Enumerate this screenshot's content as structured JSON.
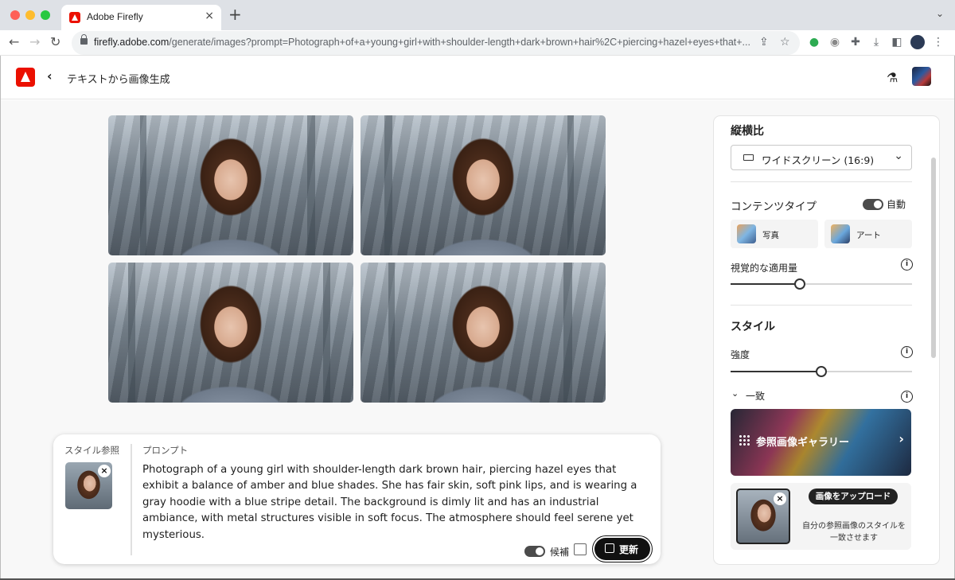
{
  "browser": {
    "tab_title": "Adobe Firefly",
    "new_tab": "+",
    "url_host": "firefly.adobe.com",
    "url_path": "/generate/images?prompt=Photograph+of+a+young+girl+with+shoulder-length+dark+brown+hair%2C+piercing+hazel+eyes+that+..."
  },
  "header": {
    "title": "テキストから画像生成"
  },
  "prompt_card": {
    "style_ref_label": "スタイル参照",
    "prompt_label": "プロンプト",
    "prompt_text": "Photograph of a young girl with shoulder-length dark brown hair, piercing hazel eyes that exhibit a balance of amber and blue shades. She has fair skin, soft pink lips, and is wearing a gray hoodie with a blue stripe detail. The background is dimly lit and has an industrial ambiance, with metal structures visible in soft focus. The atmosphere should feel serene yet mysterious.",
    "candidates_label": "候補",
    "candidates_on": true,
    "update_label": "更新"
  },
  "panel": {
    "aspect_heading": "縦横比",
    "aspect_value": "ワイドスクリーン (16:9)",
    "content_type_heading": "コンテンツタイプ",
    "auto_label": "自動",
    "auto_on": true,
    "type_photo": "写真",
    "type_art": "アート",
    "visual_intensity_label": "視覚的な適用量",
    "visual_intensity_value": 0.38,
    "style_heading": "スタイル",
    "strength_label": "強度",
    "strength_value": 0.5,
    "match_label": "一致",
    "gallery_label": "参照画像ギャラリー",
    "upload_label": "画像をアップロード",
    "upload_desc": "自分の参照画像のスタイルを一致させます"
  },
  "icons": {
    "info": "i",
    "close": "×",
    "chevron_down": "⌄",
    "chevron_right": "›",
    "back": "‹"
  },
  "colors": {
    "adobe_red": "#eb1000",
    "dark_button": "#111111"
  }
}
